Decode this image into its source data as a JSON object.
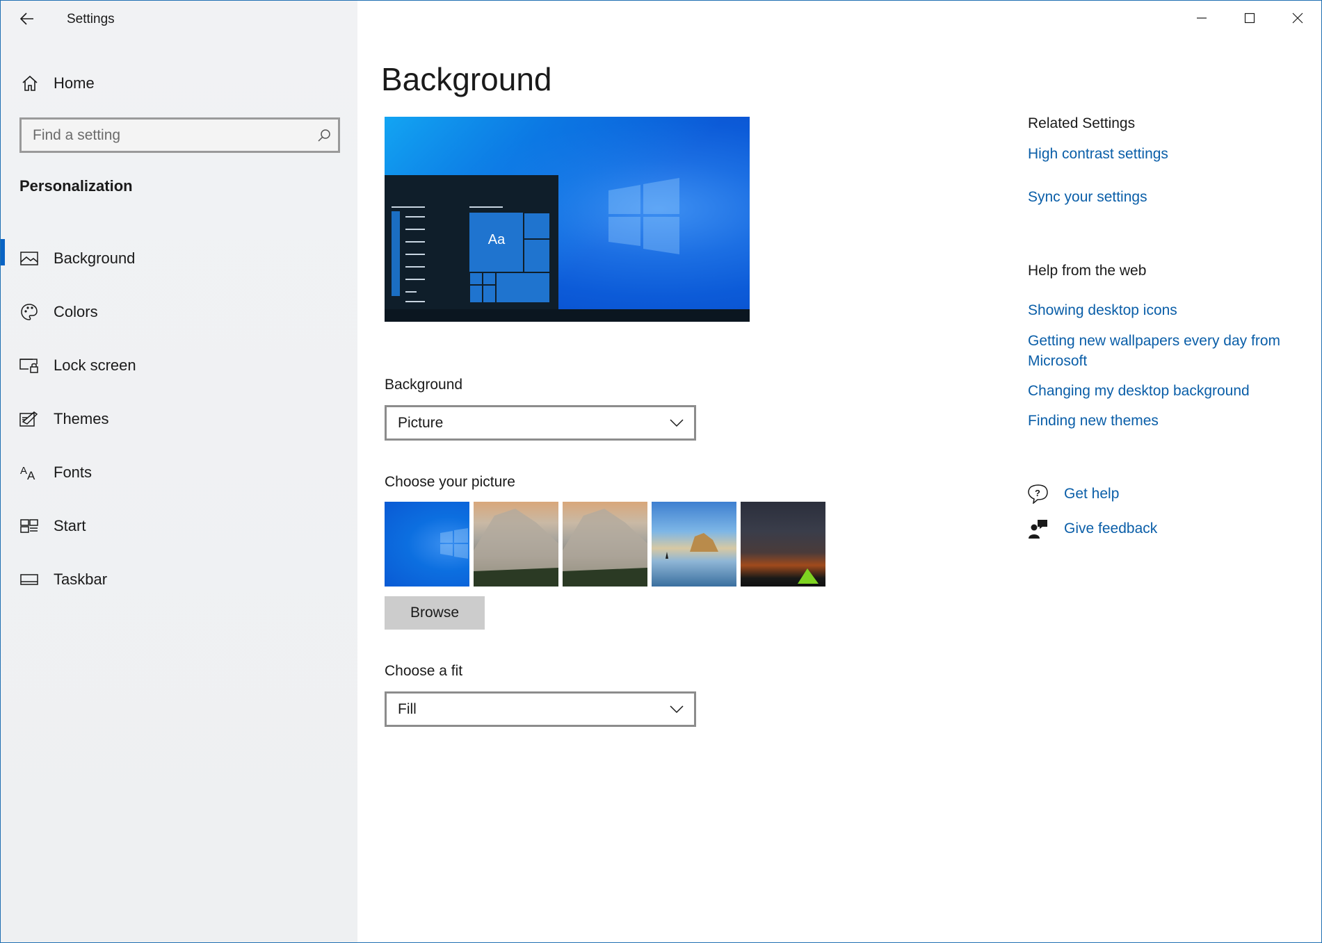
{
  "window": {
    "title": "Settings"
  },
  "sidebar": {
    "home_label": "Home",
    "search_placeholder": "Find a setting",
    "section_title": "Personalization",
    "items": [
      {
        "label": "Background",
        "icon": "picture-icon",
        "active": true
      },
      {
        "label": "Colors",
        "icon": "palette-icon",
        "active": false
      },
      {
        "label": "Lock screen",
        "icon": "lock-screen-icon",
        "active": false
      },
      {
        "label": "Themes",
        "icon": "themes-icon",
        "active": false
      },
      {
        "label": "Fonts",
        "icon": "fonts-icon",
        "active": false
      },
      {
        "label": "Start",
        "icon": "start-icon",
        "active": false
      },
      {
        "label": "Taskbar",
        "icon": "taskbar-icon",
        "active": false
      }
    ]
  },
  "main": {
    "page_title": "Background",
    "preview_tile_text": "Aa",
    "background_label": "Background",
    "background_value": "Picture",
    "choose_picture_label": "Choose your picture",
    "browse_label": "Browse",
    "fit_label": "Choose a fit",
    "fit_value": "Fill",
    "thumbnails": [
      {
        "name": "windows-blue-wallpaper"
      },
      {
        "name": "el-capitan-rock-wallpaper"
      },
      {
        "name": "el-capitan-rock-wallpaper-2"
      },
      {
        "name": "beach-rock-wallpaper"
      },
      {
        "name": "night-sky-tent-wallpaper"
      }
    ]
  },
  "right": {
    "related_heading": "Related Settings",
    "related_links": [
      "High contrast settings",
      "Sync your settings"
    ],
    "help_heading": "Help from the web",
    "help_links": [
      "Showing desktop icons",
      "Getting new wallpapers every day from Microsoft",
      "Changing my desktop background",
      "Finding new themes"
    ],
    "get_help": "Get help",
    "give_feedback": "Give feedback"
  },
  "colors": {
    "accent": "#0a64c4",
    "link": "#0a5ea8",
    "sidebar_bg": "#f1f2f4"
  }
}
